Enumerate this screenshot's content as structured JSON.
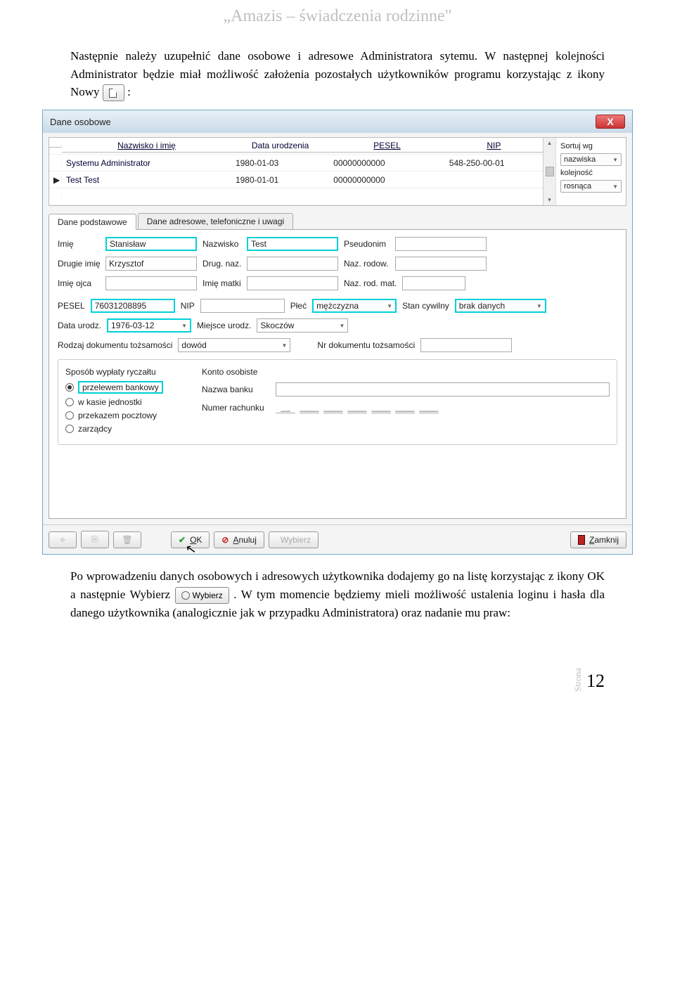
{
  "doc": {
    "header": "„Amazis – świadczenia rodzinne\"",
    "para1": "Następnie należy uzupełnić dane osobowe i adresowe Administratora sytemu. W następnej kolejności Administrator będzie miał możliwość założenia pozostałych użytkowników programu korzystając z ikony Nowy",
    "colon": ":",
    "para2a": "Po wprowadzeniu danych osobowych i adresowych użytkownika dodajemy go na listę korzystając z ikony OK a następnie Wybierz ",
    "para2b": ". W tym momencie będziemy mieli możliwość ustalenia loginu i hasła dla danego użytkownika (analogicznie jak w przypadku Administratora) oraz nadanie mu praw:",
    "wybierz_label": "Wybierz",
    "page_label": "Strona",
    "page_number": "12"
  },
  "dialog": {
    "title": "Dane osobowe",
    "sort": {
      "label1": "Sortuj wg",
      "value1": "nazwiska",
      "label2": "kolejność",
      "value2": "rosnąca"
    },
    "grid": {
      "headers": {
        "name": "Nazwisko i imię",
        "dob": "Data urodzenia",
        "pesel": "PESEL",
        "nip": "NIP"
      },
      "rows": [
        {
          "mark": "",
          "name": "Systemu Administrator",
          "dob": "1980-01-03",
          "pesel": "00000000000",
          "nip": "548-250-00-01"
        },
        {
          "mark": "▶",
          "name": "Test Test",
          "dob": "1980-01-01",
          "pesel": "00000000000",
          "nip": ""
        }
      ]
    },
    "tabs": {
      "tab1": "Dane podstawowe",
      "tab2": "Dane adresowe, telefoniczne i uwagi"
    },
    "form": {
      "imie_l": "Imię",
      "imie": "Stanisław",
      "nazwisko_l": "Nazwisko",
      "nazwisko": "Test",
      "pseudonim_l": "Pseudonim",
      "pseudonim": "",
      "drugie_l": "Drugie imię",
      "drugie": "Krzysztof",
      "drugnaz_l": "Drug. naz.",
      "drugnaz": "",
      "nazrodow_l": "Naz. rodow.",
      "nazrodow": "",
      "imieojca_l": "Imię ojca",
      "imieojca": "",
      "imiematki_l": "Imię matki",
      "imiematki": "",
      "nazrodmat_l": "Naz. rod. mat.",
      "nazrodmat": "",
      "pesel_l": "PESEL",
      "pesel": "76031208895",
      "nip_l": "NIP",
      "nip": "",
      "plec_l": "Płeć",
      "plec": "mężczyzna",
      "stan_l": "Stan cywilny",
      "stan": "brak danych",
      "dataurodz_l": "Data urodz.",
      "dataurodz": "1976-03-12",
      "miejsce_l": "Miejsce urodz.",
      "miejsce": "Skoczów",
      "rodzdok_l": "Rodzaj dokumentu tożsamości",
      "rodzdok": "dowód",
      "nrdok_l": "Nr dokumentu tożsamości",
      "nrdok": ""
    },
    "payment": {
      "title": "Sposób wypłaty ryczałtu",
      "opt1": "przelewem bankowy",
      "opt2": "w kasie jednostki",
      "opt3": "przekazem pocztowy",
      "opt4": "zarządcy",
      "konto_l": "Konto osobiste",
      "bank_l": "Nazwa banku",
      "rach_l": "Numer rachunku"
    },
    "buttons": {
      "ok": "OK",
      "anuluj": "Anuluj",
      "wybierz": "Wybierz",
      "zamknij": "Zamknij"
    }
  }
}
